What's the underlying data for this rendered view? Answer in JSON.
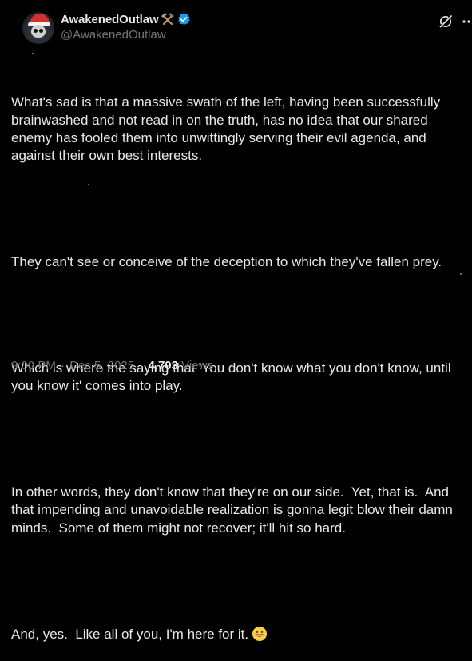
{
  "post": {
    "author": {
      "display_name": "AwakenedOutlaw",
      "name_emoji": "hammer-and-pick-icon",
      "verified": true,
      "handle": "@AwakenedOutlaw"
    },
    "paragraphs": [
      "What's sad is that a massive swath of the left, having been successfully brainwashed and not read in on the truth, has no idea that our shared enemy has fooled them into unwittingly serving their evil agenda, and against their own best interests.",
      "They can't see or conceive of the deception to which they've fallen prey.",
      "Which is where the saying that 'You don't know what you don't know, until you know it' comes into play.",
      "In other words, they don't know that they're on our side.  Yet, that is.  And that impending and unavoidable realization is gonna legit blow their damn minds.  Some of them might not recover; it'll hit so hard.",
      "And, yes.  Like all of you, I'm here for it."
    ],
    "trailing_emoji": "grinning-face-icon",
    "time": "9:00 PM",
    "date": "Dec 5, 2025",
    "separator": "·",
    "views_count": "4,703",
    "views_label": "Views"
  },
  "colors": {
    "background": "#000000",
    "text": "#e7e9ea",
    "muted": "#71767b",
    "verified": "#1d9bf0"
  }
}
